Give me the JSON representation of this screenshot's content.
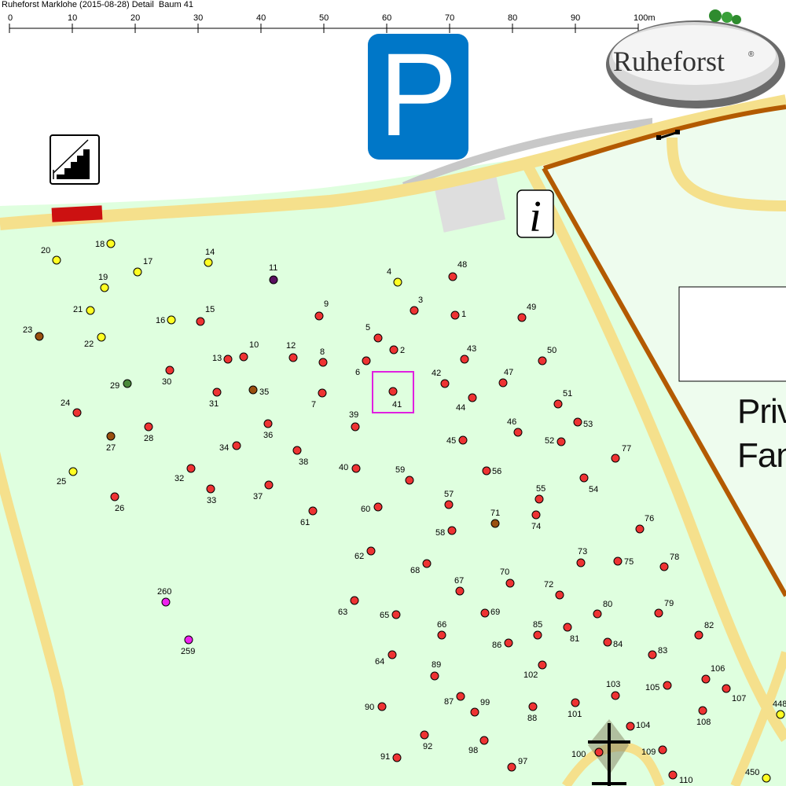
{
  "header": {
    "caption": "Ruheforst Marklohe (2015-08-28) Detail  Baum 41"
  },
  "scale": {
    "tick_labels": [
      "0",
      "10",
      "20",
      "30",
      "40",
      "50",
      "60",
      "70",
      "80",
      "90",
      "100m"
    ]
  },
  "logo": {
    "text": "Ruheforst",
    "mark": "®"
  },
  "icons": {
    "parking": "P",
    "info": "i",
    "stairs": "stairs-icon",
    "cross": "cross-icon"
  },
  "private_area": {
    "line1": "Priv",
    "line2": "Fan"
  },
  "selected_tree": "41",
  "colors": {
    "forest": "#dfffdf",
    "path": "#f5e08c",
    "boundary": "#b35a00",
    "parking": "#0077c8",
    "selection": "#e020e0",
    "tree_red": "#ee3333",
    "tree_yellow": "#ffff22",
    "tree_brown": "#9a5010",
    "tree_purple": "#5a1060",
    "tree_green": "#4a8a3a",
    "tree_magenta": "#ee22ee"
  },
  "trees": [
    {
      "id": "1",
      "c": "red"
    },
    {
      "id": "2",
      "c": "red"
    },
    {
      "id": "3",
      "c": "red"
    },
    {
      "id": "4",
      "c": "yellow"
    },
    {
      "id": "5",
      "c": "red"
    },
    {
      "id": "6",
      "c": "red"
    },
    {
      "id": "7",
      "c": "red"
    },
    {
      "id": "8",
      "c": "red"
    },
    {
      "id": "9",
      "c": "red"
    },
    {
      "id": "10",
      "c": "red"
    },
    {
      "id": "11",
      "c": "purple"
    },
    {
      "id": "12",
      "c": "red"
    },
    {
      "id": "13",
      "c": "red"
    },
    {
      "id": "14",
      "c": "yellow"
    },
    {
      "id": "15",
      "c": "red"
    },
    {
      "id": "16",
      "c": "yellow"
    },
    {
      "id": "17",
      "c": "yellow"
    },
    {
      "id": "18",
      "c": "yellow"
    },
    {
      "id": "19",
      "c": "yellow"
    },
    {
      "id": "20",
      "c": "yellow"
    },
    {
      "id": "21",
      "c": "yellow"
    },
    {
      "id": "22",
      "c": "yellow"
    },
    {
      "id": "23",
      "c": "brown"
    },
    {
      "id": "24",
      "c": "red"
    },
    {
      "id": "25",
      "c": "yellow"
    },
    {
      "id": "26",
      "c": "red"
    },
    {
      "id": "27",
      "c": "brown"
    },
    {
      "id": "28",
      "c": "red"
    },
    {
      "id": "29",
      "c": "green"
    },
    {
      "id": "30",
      "c": "red"
    },
    {
      "id": "31",
      "c": "red"
    },
    {
      "id": "32",
      "c": "red"
    },
    {
      "id": "33",
      "c": "red"
    },
    {
      "id": "34",
      "c": "red"
    },
    {
      "id": "35",
      "c": "brown"
    },
    {
      "id": "36",
      "c": "red"
    },
    {
      "id": "37",
      "c": "red"
    },
    {
      "id": "38",
      "c": "red"
    },
    {
      "id": "39",
      "c": "red"
    },
    {
      "id": "40",
      "c": "red"
    },
    {
      "id": "41",
      "c": "red"
    },
    {
      "id": "42",
      "c": "red"
    },
    {
      "id": "43",
      "c": "red"
    },
    {
      "id": "44",
      "c": "red"
    },
    {
      "id": "45",
      "c": "red"
    },
    {
      "id": "46",
      "c": "red"
    },
    {
      "id": "47",
      "c": "red"
    },
    {
      "id": "48",
      "c": "red"
    },
    {
      "id": "49",
      "c": "red"
    },
    {
      "id": "50",
      "c": "red"
    },
    {
      "id": "51",
      "c": "red"
    },
    {
      "id": "52",
      "c": "red"
    },
    {
      "id": "53",
      "c": "red"
    },
    {
      "id": "54",
      "c": "red"
    },
    {
      "id": "55",
      "c": "red"
    },
    {
      "id": "56",
      "c": "red"
    },
    {
      "id": "57",
      "c": "red"
    },
    {
      "id": "58",
      "c": "red"
    },
    {
      "id": "59",
      "c": "red"
    },
    {
      "id": "60",
      "c": "red"
    },
    {
      "id": "61",
      "c": "red"
    },
    {
      "id": "62",
      "c": "red"
    },
    {
      "id": "63",
      "c": "red"
    },
    {
      "id": "64",
      "c": "red"
    },
    {
      "id": "65",
      "c": "red"
    },
    {
      "id": "66",
      "c": "red"
    },
    {
      "id": "67",
      "c": "red"
    },
    {
      "id": "68",
      "c": "red"
    },
    {
      "id": "69",
      "c": "red"
    },
    {
      "id": "70",
      "c": "red"
    },
    {
      "id": "71",
      "c": "brown"
    },
    {
      "id": "72",
      "c": "red"
    },
    {
      "id": "73",
      "c": "red"
    },
    {
      "id": "74",
      "c": "red"
    },
    {
      "id": "75",
      "c": "red"
    },
    {
      "id": "76",
      "c": "red"
    },
    {
      "id": "77",
      "c": "red"
    },
    {
      "id": "78",
      "c": "red"
    },
    {
      "id": "79",
      "c": "red"
    },
    {
      "id": "80",
      "c": "red"
    },
    {
      "id": "81",
      "c": "red"
    },
    {
      "id": "82",
      "c": "red"
    },
    {
      "id": "83",
      "c": "red"
    },
    {
      "id": "84",
      "c": "red"
    },
    {
      "id": "85",
      "c": "red"
    },
    {
      "id": "86",
      "c": "red"
    },
    {
      "id": "87",
      "c": "red"
    },
    {
      "id": "88",
      "c": "red"
    },
    {
      "id": "89",
      "c": "red"
    },
    {
      "id": "90",
      "c": "red"
    },
    {
      "id": "91",
      "c": "red"
    },
    {
      "id": "92",
      "c": "red"
    },
    {
      "id": "97",
      "c": "red"
    },
    {
      "id": "98",
      "c": "red"
    },
    {
      "id": "99",
      "c": "red"
    },
    {
      "id": "100",
      "c": "red"
    },
    {
      "id": "101",
      "c": "red"
    },
    {
      "id": "102",
      "c": "red"
    },
    {
      "id": "103",
      "c": "red"
    },
    {
      "id": "104",
      "c": "red"
    },
    {
      "id": "105",
      "c": "red"
    },
    {
      "id": "106",
      "c": "red"
    },
    {
      "id": "107",
      "c": "red"
    },
    {
      "id": "108",
      "c": "red"
    },
    {
      "id": "109",
      "c": "red"
    },
    {
      "id": "110",
      "c": "red"
    },
    {
      "id": "259",
      "c": "magenta"
    },
    {
      "id": "260",
      "c": "magenta"
    },
    {
      "id": "448",
      "c": "yellow"
    },
    {
      "id": "450",
      "c": "yellow"
    }
  ]
}
